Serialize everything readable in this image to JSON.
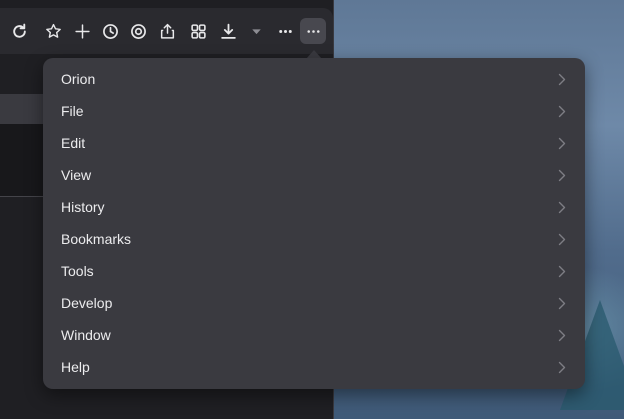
{
  "toolbar": {
    "buttons": [
      {
        "icon": "reload-icon"
      },
      {
        "icon": "star-icon"
      },
      {
        "icon": "plus-icon"
      },
      {
        "icon": "clock-icon"
      },
      {
        "icon": "target-icon"
      },
      {
        "icon": "share-icon"
      },
      {
        "icon": "grid-icon"
      },
      {
        "icon": "download-icon"
      },
      {
        "icon": "caret-down-icon"
      },
      {
        "icon": "more-dots-icon"
      },
      {
        "icon": "overflow-menu-icon"
      }
    ]
  },
  "menu": {
    "items": [
      {
        "label": "Orion"
      },
      {
        "label": "File"
      },
      {
        "label": "Edit"
      },
      {
        "label": "View"
      },
      {
        "label": "History"
      },
      {
        "label": "Bookmarks"
      },
      {
        "label": "Tools"
      },
      {
        "label": "Develop"
      },
      {
        "label": "Window"
      },
      {
        "label": "Help"
      }
    ]
  },
  "colors": {
    "menu_bg": "#3a3a40",
    "toolbar_bg": "#2a2a2f",
    "text": "#ececee",
    "chevron": "#7d7d84"
  }
}
